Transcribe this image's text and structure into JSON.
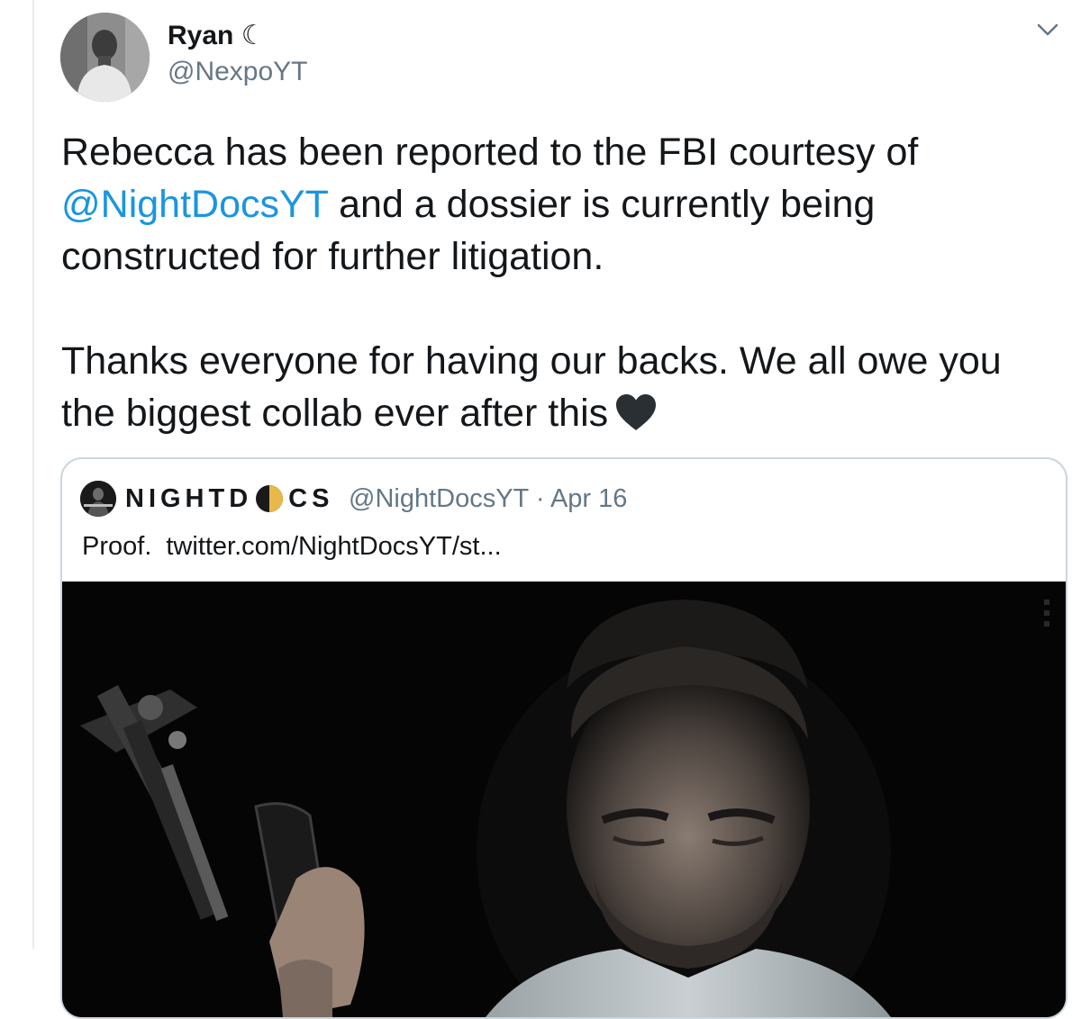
{
  "tweet": {
    "author_name": "Ryan ☾",
    "author_handle": "@NexpoYT",
    "paragraph1_before": "Rebecca has been reported to the FBI courtesy of ",
    "paragraph1_mention": "@NightDocsYT",
    "paragraph1_after": " and a dossier is currently being constructed for further litigation.",
    "paragraph2": "Thanks everyone for having our backs. We all owe you the biggest collab ever after this",
    "emoji": "black-heart-icon"
  },
  "quoted_tweet": {
    "name_part1": "NIGHTD",
    "name_part2": "CS",
    "handle": "@NightDocsYT",
    "separator": "·",
    "date": "Apr 16",
    "text_prefix": "Proof.",
    "link": "twitter.com/NightDocsYT/st..."
  },
  "colors": {
    "link_blue": "#1b95e0",
    "secondary_text": "#657786",
    "border": "#ccd6dd"
  }
}
